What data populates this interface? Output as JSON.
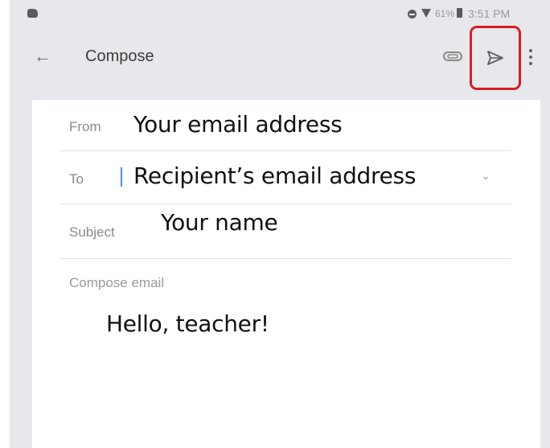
{
  "status_bar": {
    "battery_percent": "61%",
    "time": "3:51 PM"
  },
  "app_bar": {
    "back_icon": "arrow-left-icon",
    "title": "Compose",
    "attach_icon": "paperclip-icon",
    "send_icon": "send-icon",
    "more_icon": "more-vert-icon",
    "highlight_color": "#d71d23"
  },
  "compose": {
    "from_label": "From",
    "from_value": "Your email address",
    "to_label": "To",
    "to_value": "Recipient’s email address",
    "subject_label": "Subject",
    "subject_value": "Your name",
    "body_label": "Compose email",
    "body_value": "Hello, teacher!"
  }
}
